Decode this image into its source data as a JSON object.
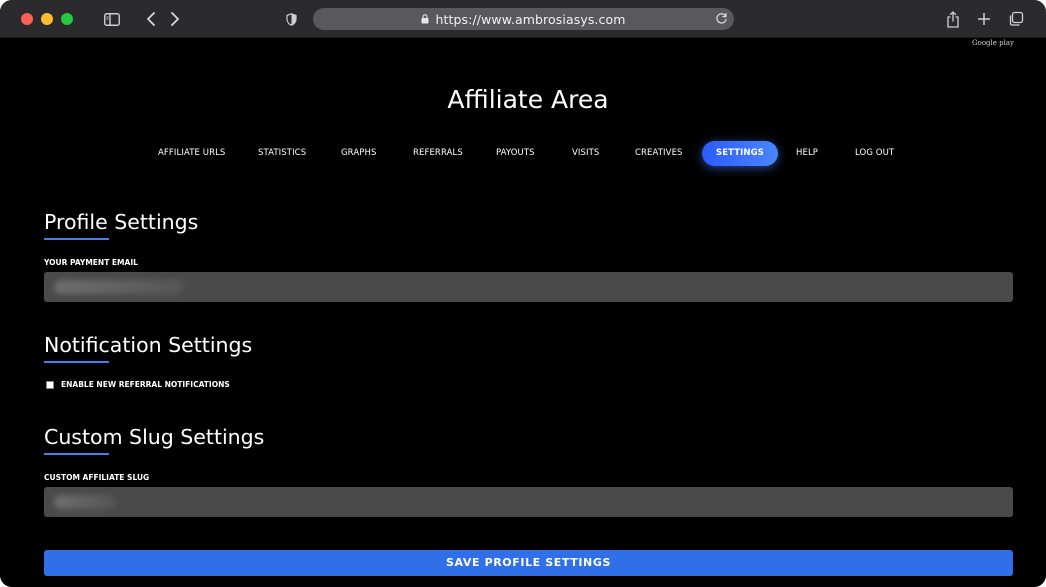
{
  "browser": {
    "url": "https://www.ambrosiasys.com"
  },
  "page": {
    "badge": "Google play",
    "title": "Affiliate Area"
  },
  "nav": {
    "items": [
      {
        "label": "AFFILIATE URLS"
      },
      {
        "label": "STATISTICS"
      },
      {
        "label": "GRAPHS"
      },
      {
        "label": "REFERRALS"
      },
      {
        "label": "PAYOUTS"
      },
      {
        "label": "VISITS"
      },
      {
        "label": "CREATIVES"
      },
      {
        "label": "SETTINGS",
        "active": true
      },
      {
        "label": "HELP"
      },
      {
        "label": "LOG OUT"
      }
    ]
  },
  "profile": {
    "title": "Profile Settings",
    "email_label": "YOUR PAYMENT EMAIL",
    "email_value": ""
  },
  "notifications": {
    "title": "Notification Settings",
    "referral_label": "ENABLE NEW REFERRAL NOTIFICATIONS",
    "referral_checked": false
  },
  "slug": {
    "title": "Custom Slug Settings",
    "label": "CUSTOM AFFILIATE SLUG",
    "value": ""
  },
  "save_button": "SAVE PROFILE SETTINGS",
  "colors": {
    "accent": "#2f6fe8",
    "nav_active": "#3b6dff",
    "underline": "#3b82f6",
    "input_bg": "#4a4a4a",
    "page_bg": "#000000"
  },
  "icons": {
    "sidebar": "sidebar-icon",
    "back": "chevron-left-icon",
    "forward": "chevron-right-icon",
    "privacy": "shield-icon",
    "lock": "lock-icon",
    "reload": "reload-icon",
    "share": "share-icon",
    "new_tab": "plus-icon",
    "tabs": "tabs-overview-icon"
  }
}
